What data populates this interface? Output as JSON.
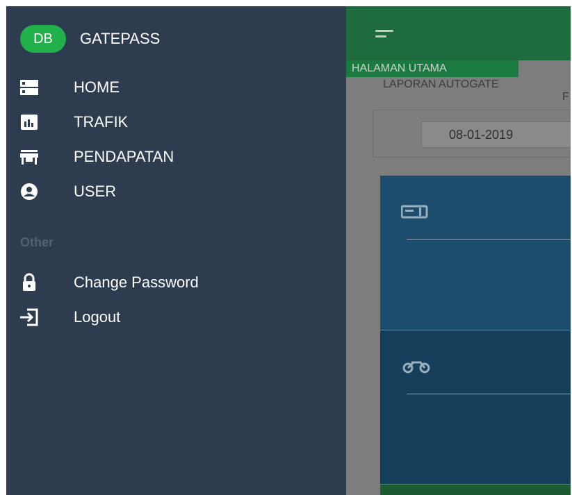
{
  "brand": {
    "initials": "DB",
    "name": "GATEPASS",
    "avatar_color": "#22b04b"
  },
  "sidebar": {
    "items": [
      {
        "label": "HOME",
        "icon": "server-icon"
      },
      {
        "label": "TRAFIK",
        "icon": "bar-chart-icon"
      },
      {
        "label": "PENDAPATAN",
        "icon": "store-icon"
      },
      {
        "label": "USER",
        "icon": "account-circle-icon"
      }
    ],
    "section_label": "Other",
    "other_items": [
      {
        "label": "Change Password",
        "icon": "lock-icon"
      },
      {
        "label": "Logout",
        "icon": "logout-icon"
      }
    ]
  },
  "main": {
    "breadcrumb": "HALAMAN UTAMA",
    "report_title_line1": "LAPORAN AUTOGATE",
    "report_title_line2": "F",
    "date_value": "08-01-2019",
    "cards": [
      {
        "icon": "card-payment-icon"
      },
      {
        "icon": "motorcycle-icon"
      }
    ]
  },
  "colors": {
    "sidebar_bg": "#2e3c4f",
    "topbar_bg": "#1e6b3e",
    "accent_green": "#22b04b"
  }
}
